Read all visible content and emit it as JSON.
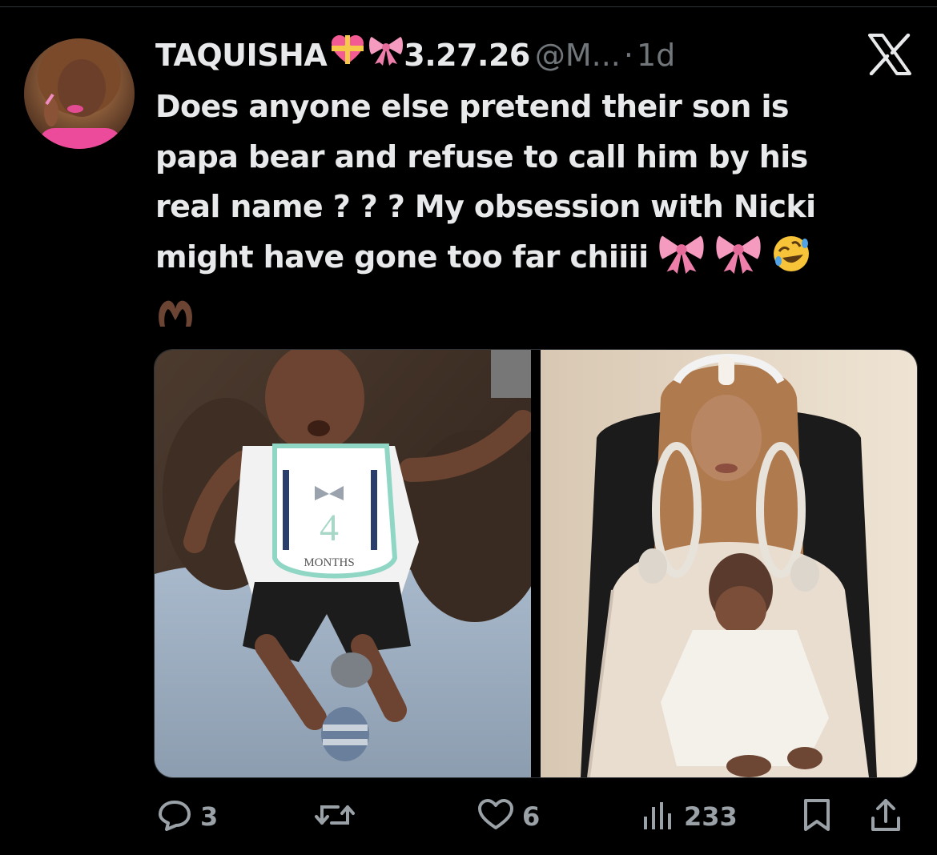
{
  "post": {
    "display_name": "TAQUISHA",
    "name_suffix": "3.27.26",
    "handle": "@M...",
    "separator": "·",
    "time": "1d",
    "text_lines": [
      "Does anyone else pretend their son is",
      "papa bear and refuse to call him by his",
      "real name ? ? ? My obsession with Nicki",
      "might have gone too far chiiii"
    ],
    "name_emojis": [
      "heart-with-ribbon-emoji",
      "pink-bow-emoji"
    ],
    "text_emojis": [
      "pink-bow-emoji",
      "pink-bow-emoji",
      "rolling-laughing-emoji",
      "heart-hands-emoji"
    ]
  },
  "media": {
    "left_photo": {
      "description_icon": "baby-photo",
      "bib_number": "4",
      "bib_text": "MONTHS"
    },
    "right_photo": {
      "description_icon": "mother-and-baby-photo"
    }
  },
  "actions": {
    "reply_count": "3",
    "repost_count": "",
    "like_count": "6",
    "views_count": "233"
  },
  "colors": {
    "background": "#000000",
    "text": "#e7e9ea",
    "secondary": "#71767b",
    "action_icon": "#9aa1a7"
  },
  "icons": [
    "x-logo-icon",
    "reply-icon",
    "repost-icon",
    "like-icon",
    "views-icon",
    "bookmark-icon",
    "share-icon"
  ]
}
